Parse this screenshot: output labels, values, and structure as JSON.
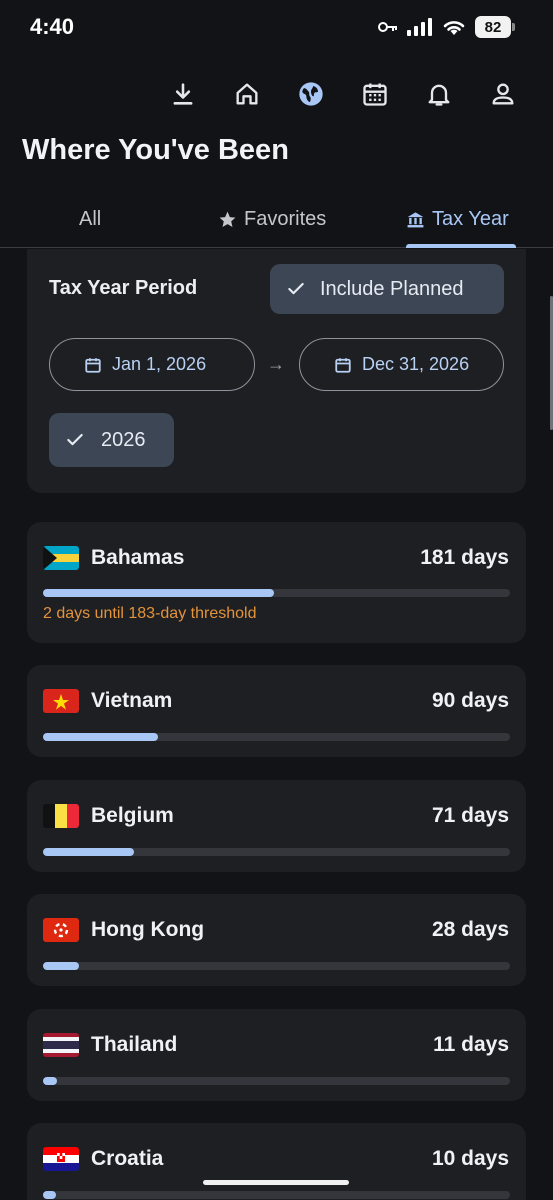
{
  "status": {
    "time": "4:40",
    "battery": "82"
  },
  "toolbar": {
    "icons": [
      "download-icon",
      "home-icon",
      "globe-icon",
      "calendar-icon",
      "bell-icon",
      "person-icon"
    ],
    "active": "globe-icon",
    "accent": "#a8c7f5"
  },
  "page": {
    "title": "Where You've Been"
  },
  "tabs": [
    {
      "label": "All",
      "icon": ""
    },
    {
      "label": "Favorites",
      "icon": "star-icon"
    },
    {
      "label": "Tax Year",
      "icon": "bank-icon"
    }
  ],
  "active_tab": "Tax Year",
  "settings": {
    "period_label": "Tax Year Period",
    "include_planned_label": "Include Planned",
    "include_planned_checked": true,
    "start_date": "Jan 1, 2026",
    "arrow": "→",
    "end_date": "Dec 31, 2026",
    "year_chip": "2026",
    "year_selected": true
  },
  "countries": [
    {
      "name": "Bahamas",
      "days": "181 days",
      "progress": 0.494,
      "note": "2 days until 183-day threshold",
      "flag": "bahamas-flag"
    },
    {
      "name": "Vietnam",
      "days": "90 days",
      "progress": 0.246,
      "note": "",
      "flag": "vietnam-flag"
    },
    {
      "name": "Belgium",
      "days": "71 days",
      "progress": 0.194,
      "note": "",
      "flag": "belgium-flag"
    },
    {
      "name": "Hong Kong",
      "days": "28 days",
      "progress": 0.077,
      "note": "",
      "flag": "hong-kong-flag"
    },
    {
      "name": "Thailand",
      "days": "11 days",
      "progress": 0.03,
      "note": "",
      "flag": "thailand-flag"
    },
    {
      "name": "Croatia",
      "days": "10 days",
      "progress": 0.027,
      "note": "",
      "flag": "croatia-flag"
    }
  ],
  "colors": {
    "warning": "#e3933a",
    "progress": "#a8c7f5",
    "background": "#121316",
    "card": "#1e1f23"
  }
}
